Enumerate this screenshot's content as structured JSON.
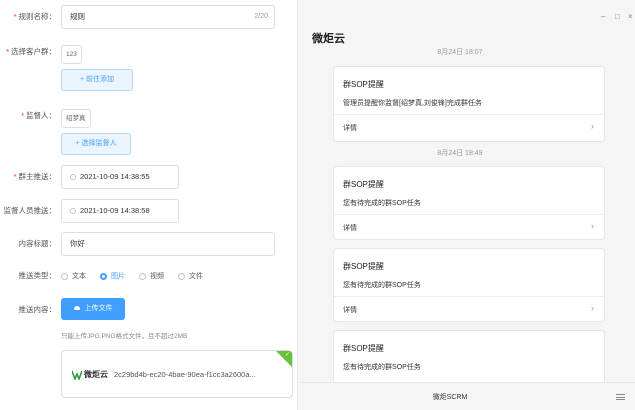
{
  "form": {
    "rule_name": {
      "label": "规则名称：",
      "value": "规则",
      "counter": "2/20"
    },
    "customer_group": {
      "label": "选择客户群：",
      "tag": "123",
      "add_button": "+ 前往添加"
    },
    "supervisor": {
      "label": "监督人：",
      "tag": "绍梦真",
      "add_button": "+ 选择监督人"
    },
    "group_push": {
      "label": "群主推送：",
      "value": "2021-10-09 14:38:55"
    },
    "supervisor_push": {
      "label": "监督人员推送：",
      "value": "2021-10-09 14:38:58"
    },
    "content_title": {
      "label": "内容标题：",
      "value": "你好"
    },
    "push_type": {
      "label": "推送类型：",
      "options": [
        "文本",
        "图片",
        "视频",
        "文件"
      ],
      "selected": "图片"
    },
    "push_content": {
      "label": "推送内容：",
      "upload_button": "上传文件",
      "hint": "只能上传JPG,PNG格式文件，且不超过2MB"
    },
    "file": {
      "brand": "微炬云",
      "name": "2c29bd4b-ec20-4bae-90ea-f1cc3a2600a..."
    }
  },
  "chat": {
    "title": "微炬云",
    "controls": {
      "minimize": "–",
      "maximize": "□",
      "close": "×"
    },
    "times": [
      "8月24日 18:07",
      "8月24日 18:49"
    ],
    "cards": [
      {
        "title": "群SOP提醒",
        "body": "管理员提醒你监督[绍梦真,刘俊锋]完成群任务",
        "more": "详情"
      },
      {
        "title": "群SOP提醒",
        "body": "您有待完成的群SOP任务",
        "more": "详情"
      },
      {
        "title": "群SOP提醒",
        "body": "您有待完成的群SOP任务",
        "more": "详情"
      },
      {
        "title": "群SOP提醒",
        "body": "您有待完成的群SOP任务",
        "more": ""
      }
    ],
    "footer": "微炬SCRM",
    "colors": {
      "accent": "#409eff",
      "success": "#67c23a"
    }
  }
}
